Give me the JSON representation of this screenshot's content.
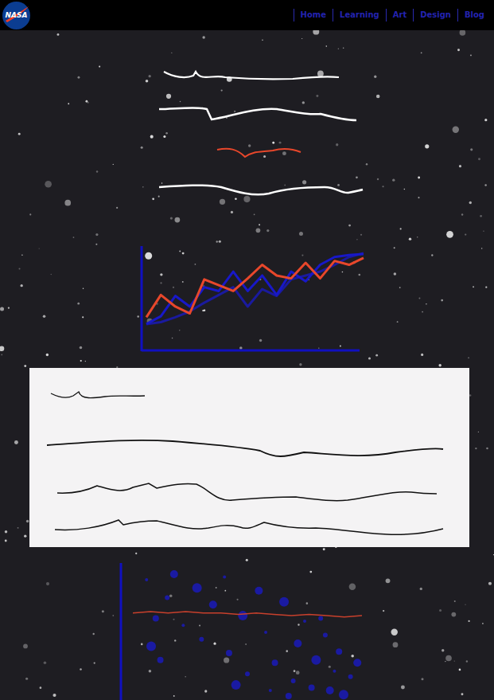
{
  "logo": {
    "text": "NASA"
  },
  "nav": [
    {
      "label": "Home"
    },
    {
      "label": "Learning"
    },
    {
      "label": "Art"
    },
    {
      "label": "Design"
    },
    {
      "label": "Blog"
    }
  ],
  "line_chart": {
    "series": [
      {
        "color": "#e8472b",
        "values": [
          30,
          53,
          41,
          34,
          69,
          63,
          57,
          70,
          84,
          73,
          70,
          86,
          70,
          88,
          84,
          91
        ]
      },
      {
        "color": "#1818c8",
        "values": [
          23,
          31,
          52,
          41,
          61,
          57,
          77,
          57,
          73,
          53,
          77,
          67,
          84,
          92,
          94,
          95
        ]
      },
      {
        "color": "#1a1a9e",
        "values": [
          23,
          25,
          30,
          36,
          45,
          53,
          61,
          41,
          59,
          52,
          69,
          73,
          77,
          84,
          92,
          96
        ]
      }
    ]
  },
  "scatter_chart": {
    "line": {
      "color": "#c8402c",
      "values": [
        64,
        65,
        64,
        65,
        64,
        64,
        63,
        64,
        63,
        62,
        63,
        62,
        61,
        62
      ]
    },
    "points": [
      [
        6,
        88
      ],
      [
        10,
        60
      ],
      [
        8,
        40
      ],
      [
        15,
        75
      ],
      [
        18,
        92
      ],
      [
        22,
        55
      ],
      [
        12,
        30
      ],
      [
        28,
        82
      ],
      [
        30,
        45
      ],
      [
        35,
        70
      ],
      [
        40,
        90
      ],
      [
        42,
        35
      ],
      [
        48,
        62
      ],
      [
        50,
        20
      ],
      [
        55,
        80
      ],
      [
        58,
        50
      ],
      [
        62,
        28
      ],
      [
        66,
        72
      ],
      [
        70,
        15
      ],
      [
        72,
        42
      ],
      [
        75,
        58
      ],
      [
        78,
        10
      ],
      [
        80,
        30
      ],
      [
        84,
        48
      ],
      [
        86,
        8
      ],
      [
        88,
        22
      ],
      [
        90,
        36
      ],
      [
        92,
        5
      ],
      [
        95,
        18
      ],
      [
        98,
        28
      ],
      [
        60,
        8
      ],
      [
        68,
        4
      ],
      [
        45,
        12
      ],
      [
        82,
        60
      ]
    ]
  }
}
